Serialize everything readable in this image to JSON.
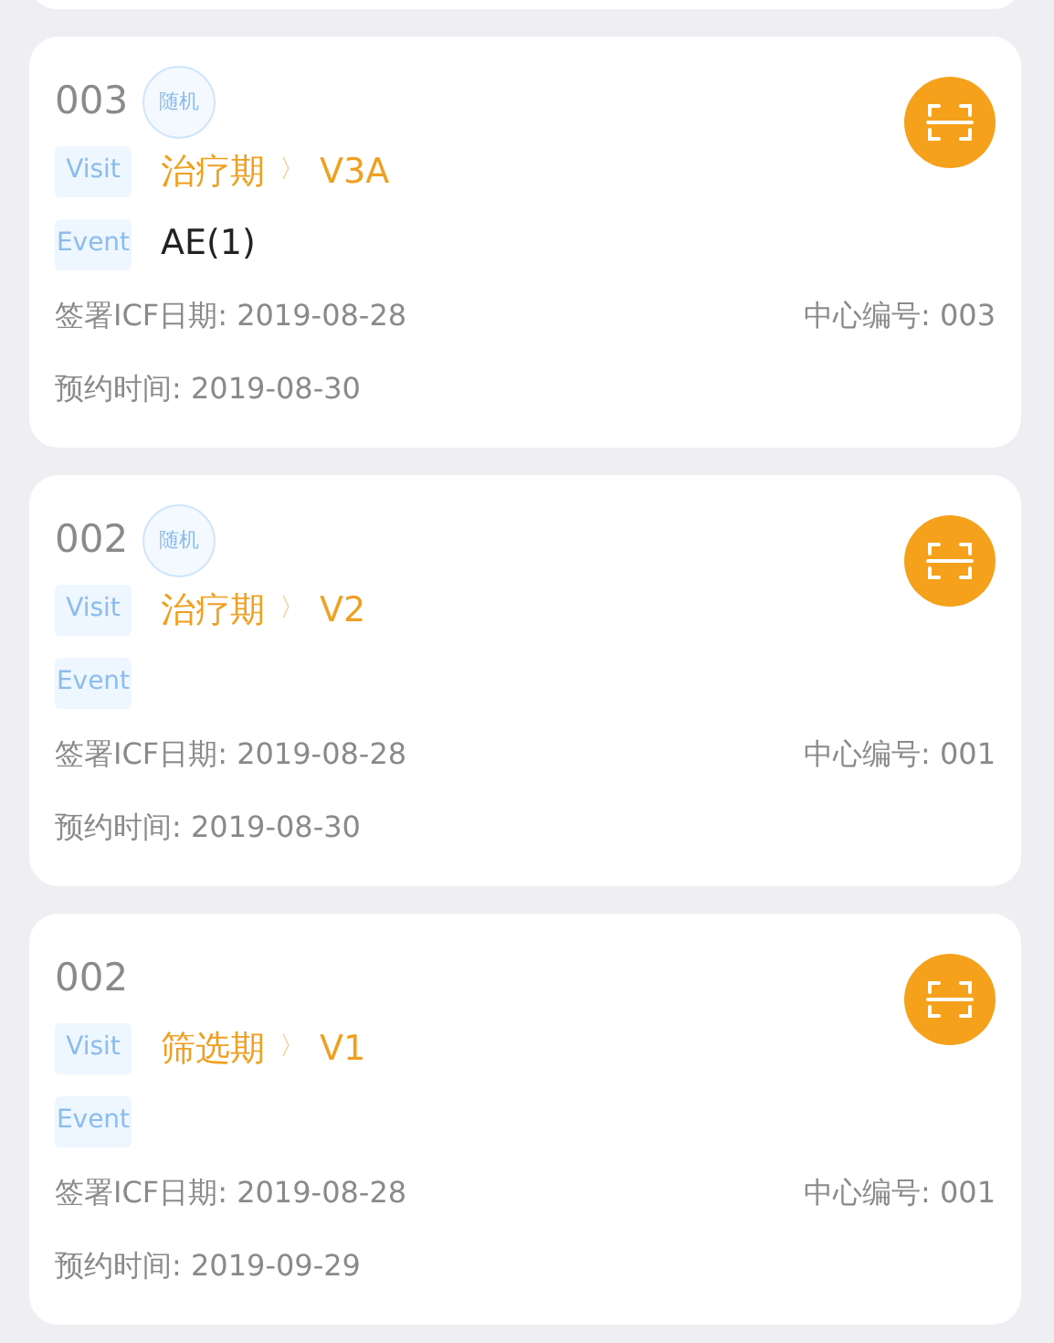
{
  "cards": [
    {
      "number": "003",
      "badge": "随机",
      "visit_label": "Visit",
      "phase": "治疗期",
      "separator": "〉",
      "visit": "V3A",
      "event_label": "Event",
      "event": "AE(1)",
      "icf": "签署ICF日期: 2019-08-28",
      "center": "中心编号: 003",
      "appointment": "预约时间: 2019-08-30"
    },
    {
      "number": "002",
      "badge": "随机",
      "visit_label": "Visit",
      "phase": "治疗期",
      "separator": "〉",
      "visit": "V2",
      "event_label": "Event",
      "icf": "签署ICF日期: 2019-08-28",
      "center": "中心编号: 001",
      "appointment": "预约时间: 2019-08-30"
    },
    {
      "number": "002",
      "visit_label": "Visit",
      "phase": "筛选期",
      "separator": "〉",
      "visit": "V1",
      "event_label": "Event",
      "icf": "签署ICF日期: 2019-08-28",
      "center": "中心编号: 001",
      "appointment": "预约时间: 2019-09-29"
    }
  ]
}
